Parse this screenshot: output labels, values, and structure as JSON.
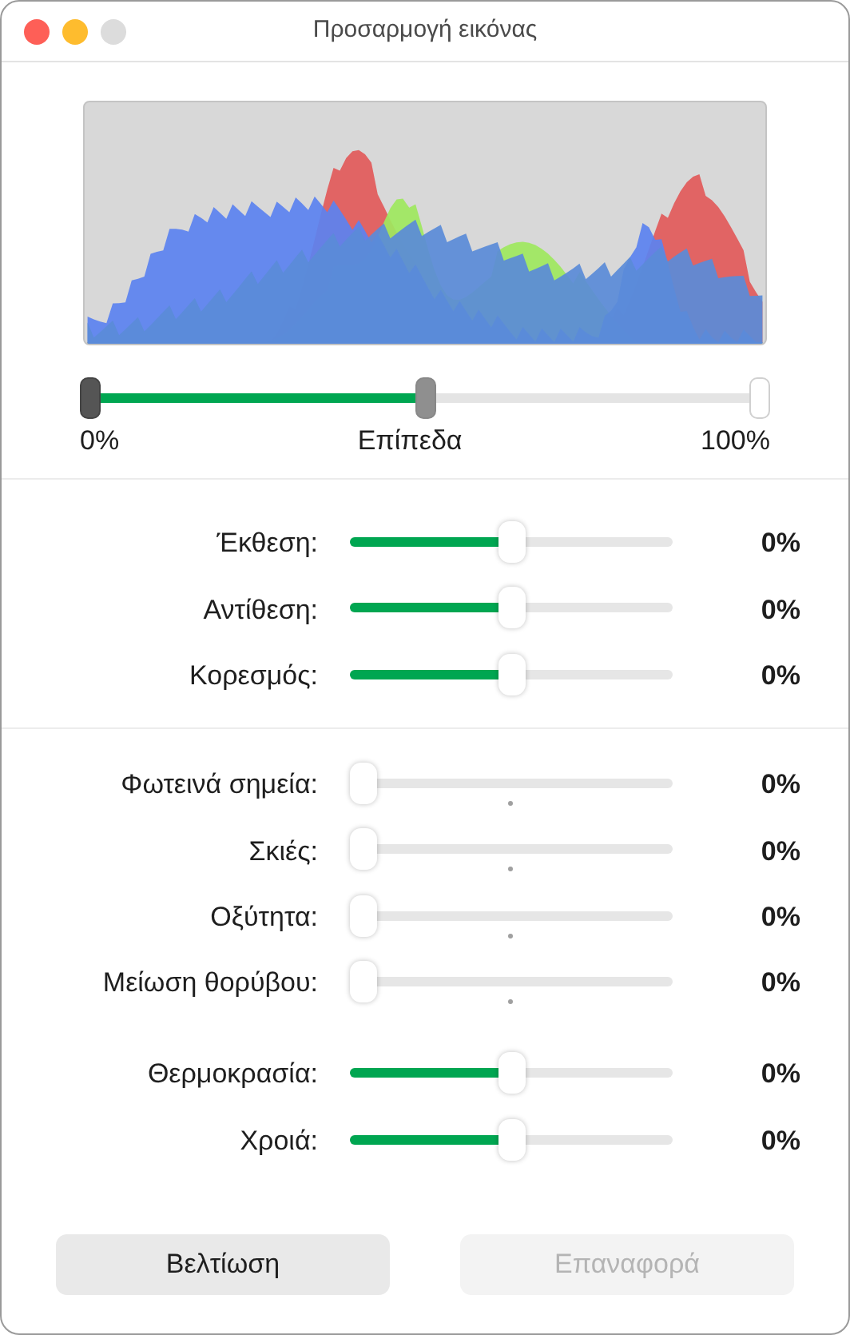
{
  "window": {
    "title": "Προσαρμογή εικόνας"
  },
  "levels": {
    "min_label": "0%",
    "label": "Επίπεδα",
    "max_label": "100%",
    "thumbs": [
      {
        "kind": "black",
        "level": 0
      },
      {
        "kind": "gray",
        "level": 0.5
      },
      {
        "kind": "white",
        "level": 1
      }
    ]
  },
  "groups": [
    {
      "rows": [
        {
          "label": "Έκθεση:",
          "kind": "plain",
          "level": 0.5,
          "reading": "0%"
        },
        {
          "label": "Αντίθεση:",
          "kind": "plain",
          "level": 0.5,
          "reading": "0%"
        },
        {
          "label": "Κορεσμός:",
          "kind": "plain",
          "level": 0.5,
          "reading": "0%"
        }
      ]
    },
    {
      "rows": [
        {
          "label": "Φωτεινά σημεία:",
          "kind": "ticked",
          "level": 0,
          "reading": "0%"
        },
        {
          "label": "Σκιές:",
          "kind": "ticked",
          "level": 0,
          "reading": "0%"
        },
        {
          "label": "Οξύτητα:",
          "kind": "ticked",
          "level": 0,
          "reading": "0%"
        },
        {
          "label": "Μείωση θορύβου:",
          "kind": "ticked",
          "level": 0,
          "reading": "0%"
        }
      ]
    },
    {
      "rows": [
        {
          "label": "Θερμοκρασία:",
          "kind": "plain",
          "level": 0.5,
          "reading": "0%"
        },
        {
          "label": "Χροιά:",
          "kind": "plain",
          "level": 0.5,
          "reading": "0%"
        }
      ]
    }
  ],
  "buttons": [
    {
      "label": "Βελτίωση",
      "disabled": false
    },
    {
      "label": "Επαναφορά",
      "disabled": true
    }
  ]
}
